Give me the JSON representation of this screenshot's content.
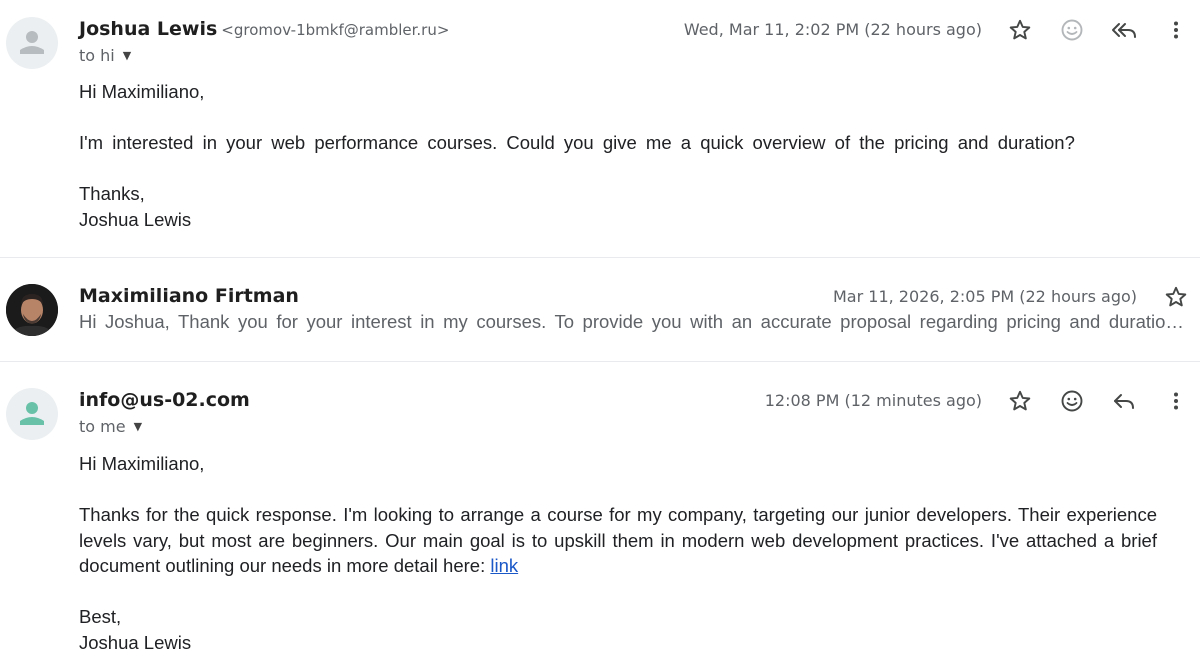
{
  "messages": [
    {
      "sender_name": "Joshua Lewis",
      "sender_email": "<gromov-1bmkf@rambler.ru>",
      "recipients": "to hi",
      "date": "Wed, Mar 11, 2:02 PM (22 hours ago)",
      "body": {
        "greeting": "Hi Maximiliano,",
        "paragraph": "I'm interested in your web performance courses. Could you give me a quick overview of the pricing and duration?",
        "signoff": "Thanks,",
        "signature": "Joshua Lewis"
      }
    },
    {
      "sender_name": "Maximiliano Firtman",
      "date": "Mar 11, 2026, 2:05 PM (22 hours ago)",
      "snippet": "Hi Joshua, Thank you for your interest in my courses. To provide you with an accurate proposal regarding pricing and duration, could you please clarify"
    },
    {
      "sender_name": "info@us-02.com",
      "recipients": "to me",
      "date": "12:08 PM (12 minutes ago)",
      "body": {
        "greeting": "Hi Maximiliano,",
        "paragraph": "Thanks for the quick response. I'm looking to arrange a course for my company, targeting our junior developers. Their experience levels vary, but most are beginners. Our main goal is to upskill them in modern web development practices. I've attached a brief document outlining our needs in more detail here:",
        "link_text": "link",
        "signoff": "Best,",
        "signature": "Joshua Lewis"
      }
    }
  ],
  "icons": {
    "star": "star-icon",
    "emoji": "emoji-smile-icon",
    "reply_all": "reply-all-icon",
    "reply": "reply-icon",
    "more": "more-vert-icon",
    "dropdown": "arrow-drop-down-icon"
  },
  "colors": {
    "link": "#1a57c7",
    "secondary_text": "#5f6368",
    "avatar_person_green": "#69c2a8",
    "avatar_person_gray": "#b7bcc0"
  }
}
